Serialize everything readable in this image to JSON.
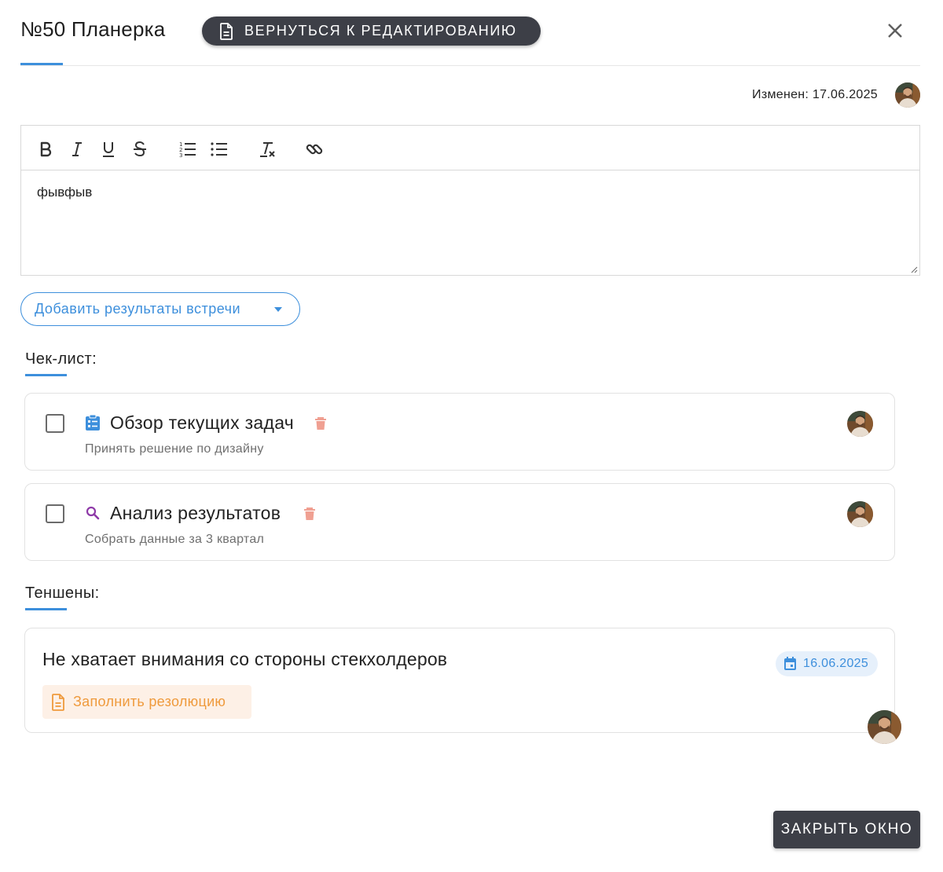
{
  "header": {
    "title": "№50 Планерка",
    "back_button_label": "ВЕРНУТЬСЯ К РЕДАКТИРОВАНИЮ"
  },
  "meta": {
    "modified_label": "Изменен: 17.06.2025"
  },
  "editor": {
    "toolbar": [
      "bold-icon",
      "italic-icon",
      "underline-icon",
      "strikethrough-icon",
      "ordered-list-icon",
      "bullet-list-icon",
      "clear-format-icon",
      "link-icon"
    ],
    "content": "фывфыв"
  },
  "add_results": {
    "label": "Добавить результаты встречи"
  },
  "checklist": {
    "title": "Чек-лист:",
    "items": [
      {
        "title": "Обзор текущих задач",
        "subtitle": "Принять решение по дизайну",
        "icon": "clipboard-icon",
        "icon_color": "#3d8fdc"
      },
      {
        "title": "Анализ результатов",
        "subtitle": "Собрать данные за 3 квартал",
        "icon": "search-icon",
        "icon_color": "#8e3aa8"
      }
    ]
  },
  "tensions": {
    "title": "Теншены:",
    "items": [
      {
        "title": "Не хватает внимания со стороны стекхолдеров",
        "date": "16.06.2025",
        "resolution_label": "Заполнить резолюцию"
      }
    ]
  },
  "footer": {
    "close_label": "ЗАКРЫТЬ ОКНО"
  },
  "colors": {
    "accent": "#3d8fdc",
    "dark_button": "#3d3f47",
    "trash": "#f0a092",
    "resolution_text": "#ef9a3c",
    "resolution_bg": "#fdf0e6"
  }
}
